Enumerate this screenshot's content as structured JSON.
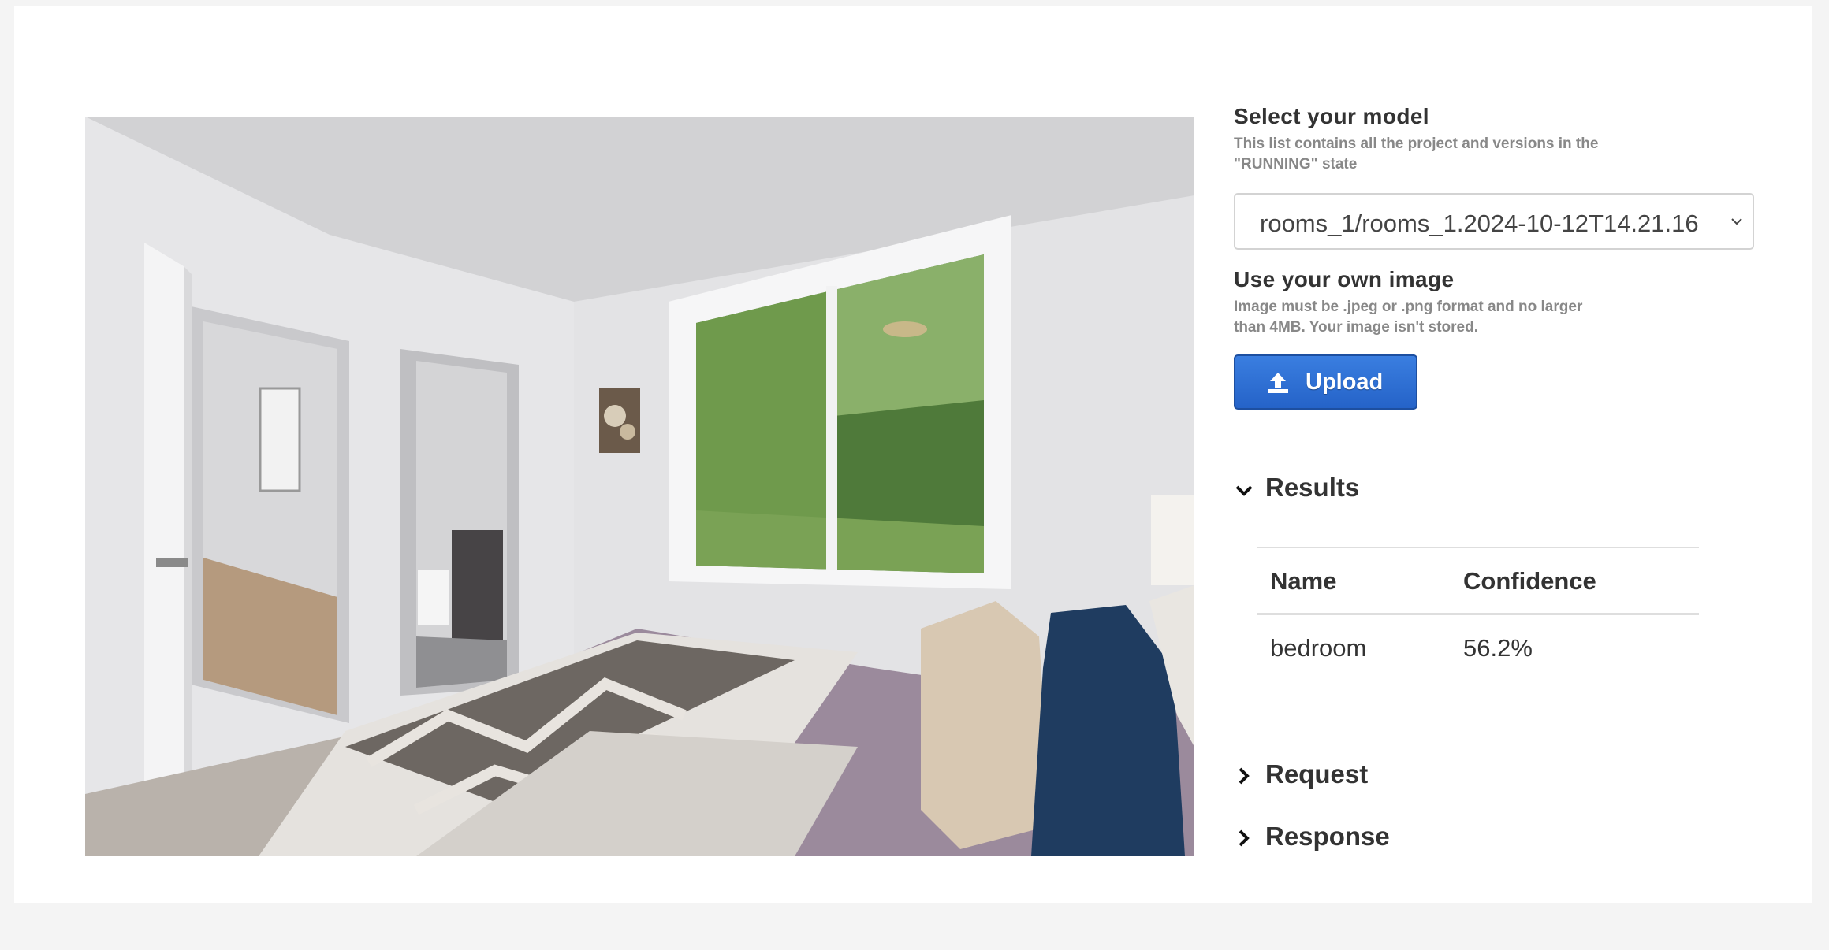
{
  "model": {
    "heading": "Select your model",
    "help": "This list contains all the project and versions in the \"RUNNING\" state",
    "selected": "rooms_1/rooms_1.2024-10-12T14.21.16"
  },
  "own_image": {
    "heading": "Use your own image",
    "help": "Image must be .jpeg or .png format and no larger than 4MB. Your image isn't stored.",
    "upload_label": "Upload"
  },
  "results": {
    "title": "Results",
    "columns": [
      "Name",
      "Confidence"
    ],
    "rows": [
      {
        "name": "bedroom",
        "confidence": "56.2%"
      }
    ]
  },
  "request": {
    "title": "Request"
  },
  "response": {
    "title": "Response"
  },
  "colors": {
    "upload_button": "#2a6bd3",
    "page_background": "#f4f4f4",
    "card_background": "#ffffff"
  },
  "icons": {
    "upload": "upload-icon",
    "select": "chevron-down-icon",
    "results": "chevron-down-icon",
    "request": "chevron-right-icon",
    "response": "chevron-right-icon"
  }
}
